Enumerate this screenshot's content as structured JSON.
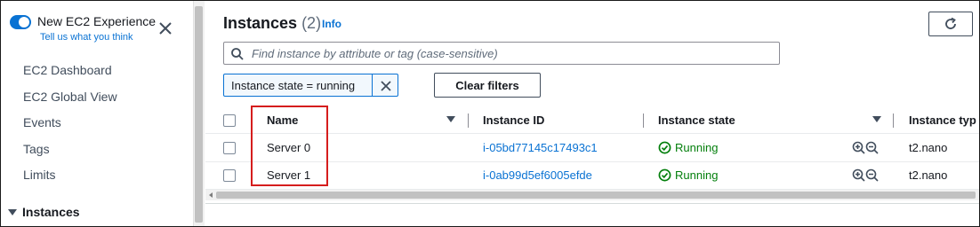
{
  "sidebar": {
    "experience_title": "New EC2 Experience",
    "experience_link": "Tell us what you think",
    "items": [
      {
        "label": "EC2 Dashboard"
      },
      {
        "label": "EC2 Global View"
      },
      {
        "label": "Events"
      },
      {
        "label": "Tags"
      },
      {
        "label": "Limits"
      }
    ],
    "section_label": "Instances"
  },
  "header": {
    "title": "Instances",
    "count": "(2)",
    "info_link": "Info"
  },
  "search": {
    "placeholder": "Find instance by attribute or tag (case-sensitive)"
  },
  "filters": {
    "active_filter": "Instance state = running",
    "clear_label": "Clear filters"
  },
  "table": {
    "columns": [
      "Name",
      "Instance ID",
      "Instance state",
      "Instance typ"
    ],
    "rows": [
      {
        "name": "Server 0",
        "instance_id": "i-05bd77145c17493c1",
        "state": "Running",
        "type": "t2.nano"
      },
      {
        "name": "Server 1",
        "instance_id": "i-0ab99d5ef6005efde",
        "state": "Running",
        "type": "t2.nano"
      }
    ]
  },
  "colors": {
    "accent": "#0972d3",
    "running": "#037f0c",
    "highlight": "#d51d1d"
  },
  "icons": {
    "toggle": "toggle-on-icon",
    "close": "close-icon",
    "refresh": "refresh-icon",
    "search": "search-icon",
    "filter_remove": "close-icon",
    "status": "check-circle-icon",
    "zoom": "zoom-in-out-icon",
    "sort": "caret-down-icon"
  }
}
